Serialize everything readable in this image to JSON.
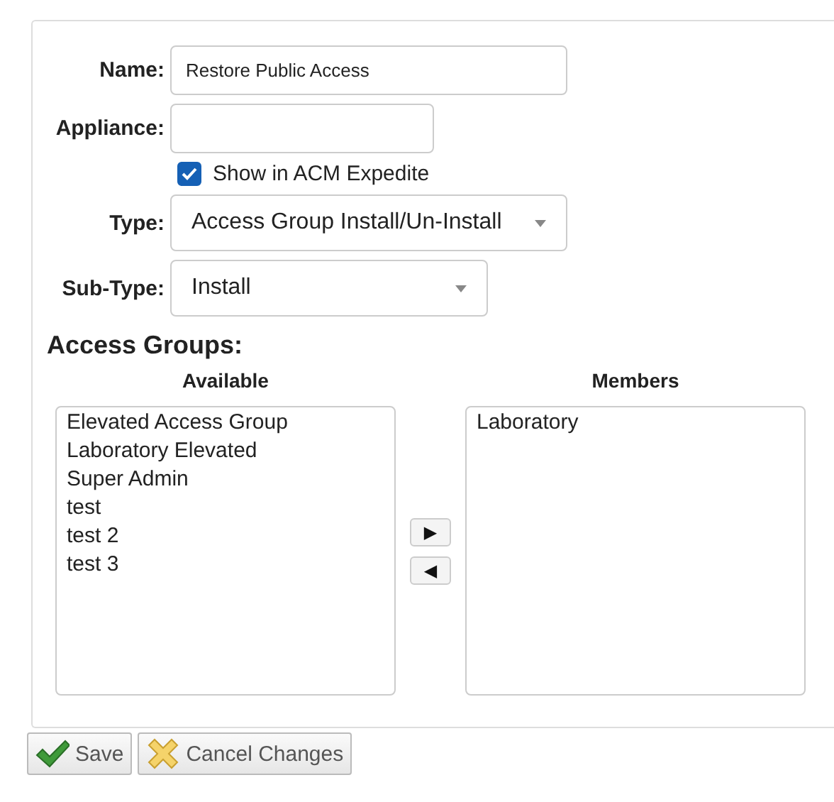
{
  "form": {
    "name": {
      "label": "Name:",
      "value": "Restore Public Access"
    },
    "appliance": {
      "label": "Appliance:"
    },
    "expedite": {
      "label": "Show in ACM Expedite",
      "checked": true
    },
    "type": {
      "label": "Type:",
      "value": "Access Group Install/Un-Install"
    },
    "sub_type": {
      "label": "Sub-Type:",
      "value": "Install"
    }
  },
  "access_groups": {
    "title": "Access Groups:",
    "available": {
      "heading": "Available",
      "items": [
        "Elevated Access Group",
        "Laboratory Elevated",
        "Super Admin",
        "test",
        "test 2",
        "test 3"
      ]
    },
    "members": {
      "heading": "Members",
      "items": [
        "Laboratory"
      ]
    },
    "move_buttons": [
      "▶",
      "◀"
    ]
  },
  "buttons": [
    {
      "kind": "save",
      "label": "Save"
    },
    {
      "kind": "cancel",
      "label": "Cancel Changes"
    }
  ]
}
